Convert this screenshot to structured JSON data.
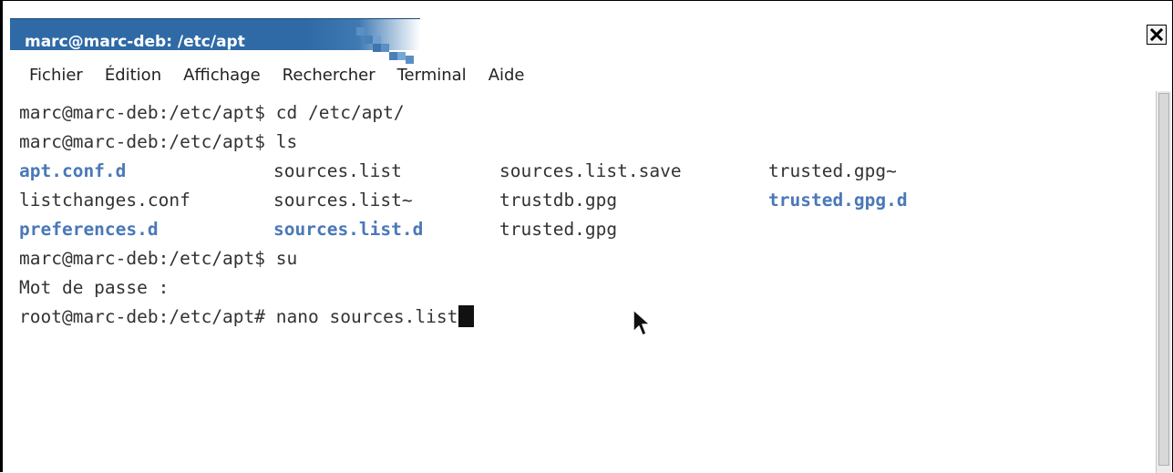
{
  "window": {
    "title": "marc@marc-deb: /etc/apt"
  },
  "menu": [
    {
      "label": "Fichier"
    },
    {
      "label": "Édition"
    },
    {
      "label": "Affichage"
    },
    {
      "label": "Rechercher"
    },
    {
      "label": "Terminal"
    },
    {
      "label": "Aide"
    }
  ],
  "terminal": {
    "lines": [
      "marc@marc-deb:/etc/apt$ cd /etc/apt/",
      "marc@marc-deb:/etc/apt$ ls"
    ],
    "ls_rows": [
      [
        {
          "text": "apt.conf.d",
          "is_dir": true
        },
        {
          "text": "sources.list",
          "is_dir": false
        },
        {
          "text": "sources.list.save",
          "is_dir": false
        },
        {
          "text": "trusted.gpg~",
          "is_dir": false
        }
      ],
      [
        {
          "text": "listchanges.conf",
          "is_dir": false
        },
        {
          "text": "sources.list~",
          "is_dir": false
        },
        {
          "text": "trustdb.gpg",
          "is_dir": false
        },
        {
          "text": "trusted.gpg.d",
          "is_dir": true
        }
      ],
      [
        {
          "text": "preferences.d",
          "is_dir": true
        },
        {
          "text": "sources.list.d",
          "is_dir": true
        },
        {
          "text": "trusted.gpg",
          "is_dir": false
        },
        {
          "text": "",
          "is_dir": false
        }
      ]
    ],
    "after_lines": [
      "marc@marc-deb:/etc/apt$ su",
      "Mot de passe :"
    ],
    "current_prompt": "root@marc-deb:/etc/apt# nano sources.list"
  },
  "colors": {
    "titlebar": "#2f6aa6",
    "directory": "#4a78b8",
    "text": "#333333"
  },
  "icons": {
    "close": "close-icon",
    "mouse": "mouse-pointer-icon"
  }
}
